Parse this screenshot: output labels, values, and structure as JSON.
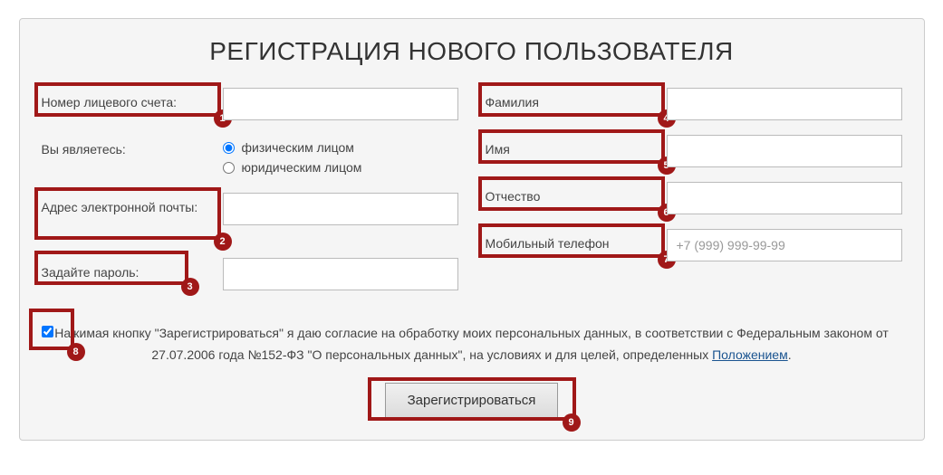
{
  "title": "РЕГИСТРАЦИЯ НОВОГО ПОЛЬЗОВАТЕЛЯ",
  "left": {
    "account_label": "Номер лицевого счета:",
    "account_value": "",
    "you_are_label": "Вы являетесь:",
    "radio_individual": "физическим лицом",
    "radio_legal": "юридическим лицом",
    "email_label": "Адрес электронной почты:",
    "email_value": "",
    "password_label": "Задайте пароль:",
    "password_value": ""
  },
  "right": {
    "lastname_label": "Фамилия",
    "lastname_value": "",
    "firstname_label": "Имя",
    "firstname_value": "",
    "patronymic_label": "Отчество",
    "patronymic_value": "",
    "phone_label": "Мобильный телефон",
    "phone_placeholder": "+7 (999) 999-99-99",
    "phone_value": ""
  },
  "consent": {
    "text_before": "Нажимая кнопку \"Зарегистрироваться\" я даю согласие на обработку моих персональных данных, в соответствии с Федеральным законом от 27.07.2006 года №152-ФЗ \"О персональных данных\", на условиях и для целей, определенных ",
    "link_text": "Положением",
    "text_after": "."
  },
  "submit_label": "Зарегистрироваться",
  "badges": [
    "1",
    "2",
    "3",
    "4",
    "5",
    "6",
    "7",
    "8",
    "9"
  ]
}
